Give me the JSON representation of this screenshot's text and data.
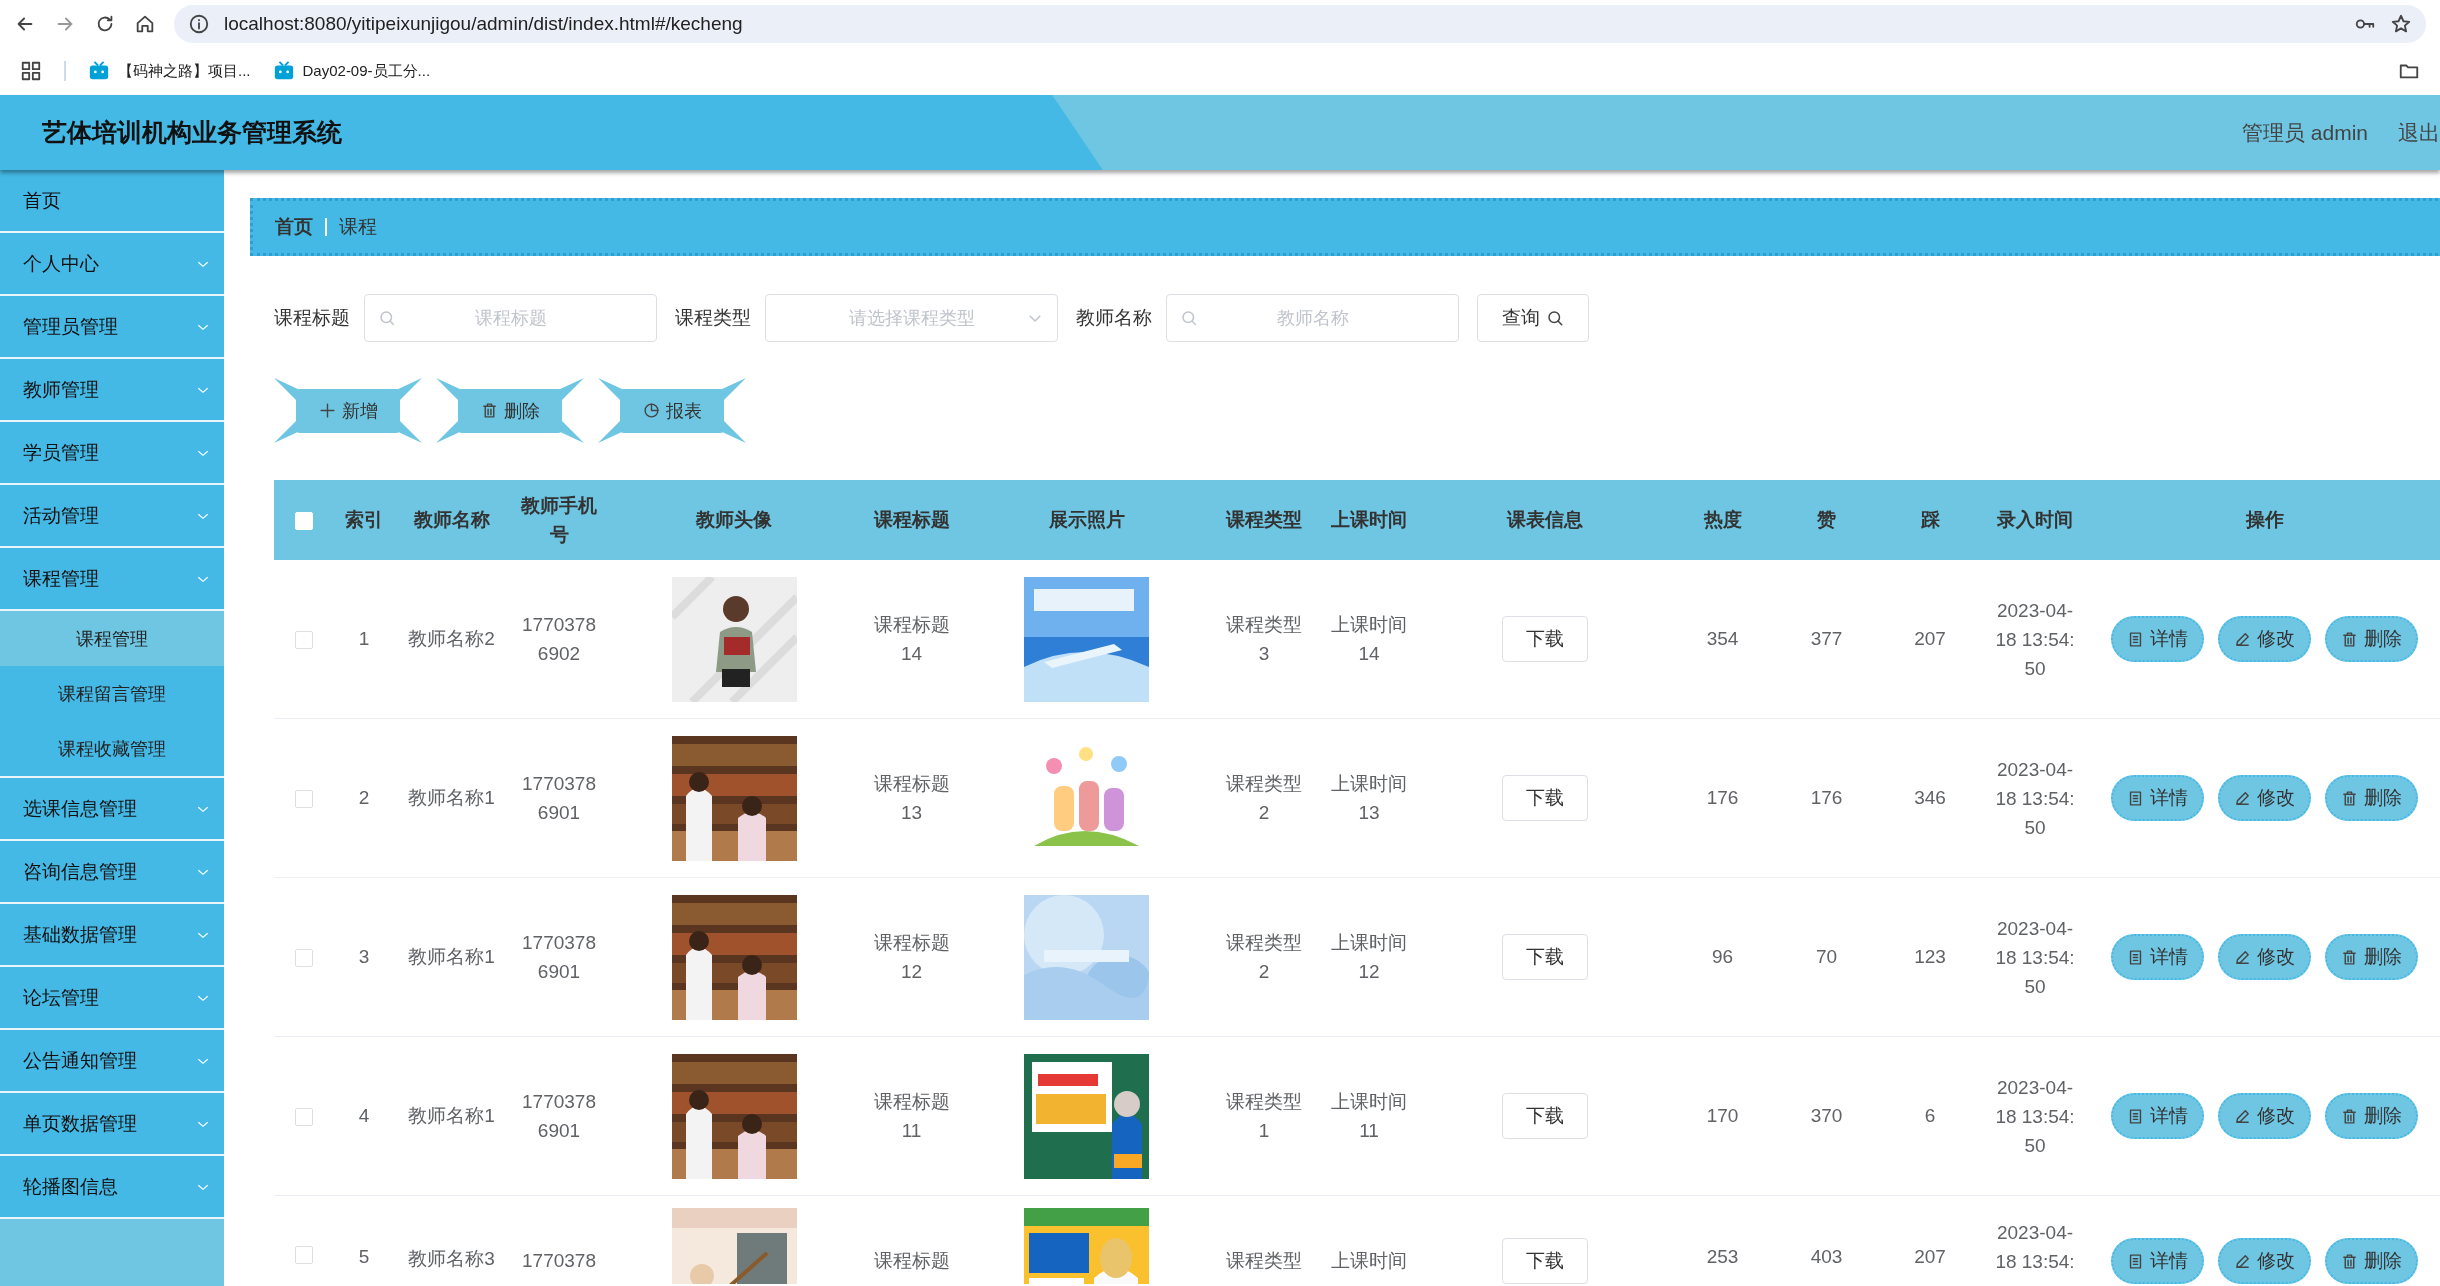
{
  "browser": {
    "url": "localhost:8080/yitipeixunjigou/admin/dist/index.html#/kecheng",
    "bookmarks": [
      "【码神之路】项目...",
      "Day02-09-员工分..."
    ]
  },
  "header": {
    "title": "艺体培训机构业务管理系统",
    "user": "管理员 admin",
    "logout": "退出"
  },
  "sidebar": {
    "items": [
      {
        "label": "首页",
        "kind": "link"
      },
      {
        "label": "个人中心",
        "kind": "menu"
      },
      {
        "label": "管理员管理",
        "kind": "menu"
      },
      {
        "label": "教师管理",
        "kind": "menu"
      },
      {
        "label": "学员管理",
        "kind": "menu"
      },
      {
        "label": "活动管理",
        "kind": "menu"
      },
      {
        "label": "课程管理",
        "kind": "menu",
        "children": [
          {
            "label": "课程管理",
            "selected": true
          },
          {
            "label": "课程留言管理",
            "selected": false
          },
          {
            "label": "课程收藏管理",
            "selected": false
          }
        ]
      },
      {
        "label": "选课信息管理",
        "kind": "menu"
      },
      {
        "label": "咨询信息管理",
        "kind": "menu"
      },
      {
        "label": "基础数据管理",
        "kind": "menu"
      },
      {
        "label": "论坛管理",
        "kind": "menu"
      },
      {
        "label": "公告通知管理",
        "kind": "menu"
      },
      {
        "label": "单页数据管理",
        "kind": "menu"
      },
      {
        "label": "轮播图信息",
        "kind": "menu"
      }
    ]
  },
  "breadcrumb": [
    "首页",
    "课程"
  ],
  "filters": [
    {
      "label": "课程标题",
      "kind": "search",
      "placeholder": "课程标题"
    },
    {
      "label": "课程类型",
      "kind": "select",
      "placeholder": "请选择课程类型"
    },
    {
      "label": "教师名称",
      "kind": "search",
      "placeholder": "教师名称"
    }
  ],
  "query_button": "查询",
  "actions": [
    {
      "label": "新增",
      "kind": "add"
    },
    {
      "label": "删除",
      "kind": "delete"
    },
    {
      "label": "报表",
      "kind": "report"
    }
  ],
  "table": {
    "select_all_checked": false,
    "columns": [
      "索引",
      "教师名称",
      "教师手机号",
      "教师头像",
      "课程标题",
      "展示照片",
      "课程类型",
      "上课时间",
      "课表信息",
      "热度",
      "赞",
      "踩",
      "录入时间",
      "操作"
    ],
    "rows": [
      {
        "checked": false,
        "cut": false,
        "index": "1",
        "teacher": "教师名称2",
        "phone": "17703786902",
        "avatar": {
          "kind": "picture"
        },
        "title": "课程标题14",
        "photo": {
          "kind": "picture"
        },
        "type": "课程类型3",
        "time": "上课时间14",
        "schedule": "下载",
        "heat": "354",
        "likes": "377",
        "dislikes": "207",
        "created": "2023-04-18 13:54:50",
        "actions": [
          "详情",
          "修改",
          "删除"
        ]
      },
      {
        "checked": false,
        "cut": false,
        "index": "2",
        "teacher": "教师名称1",
        "phone": "17703786901",
        "avatar": {
          "kind": "picture"
        },
        "title": "课程标题13",
        "photo": {
          "kind": "picture"
        },
        "type": "课程类型2",
        "time": "上课时间13",
        "schedule": "下载",
        "heat": "176",
        "likes": "176",
        "dislikes": "346",
        "created": "2023-04-18 13:54:50",
        "actions": [
          "详情",
          "修改",
          "删除"
        ]
      },
      {
        "checked": false,
        "cut": false,
        "index": "3",
        "teacher": "教师名称1",
        "phone": "17703786901",
        "avatar": {
          "kind": "picture"
        },
        "title": "课程标题12",
        "photo": {
          "kind": "picture"
        },
        "type": "课程类型2",
        "time": "上课时间12",
        "schedule": "下载",
        "heat": "96",
        "likes": "70",
        "dislikes": "123",
        "created": "2023-04-18 13:54:50",
        "actions": [
          "详情",
          "修改",
          "删除"
        ]
      },
      {
        "checked": false,
        "cut": false,
        "index": "4",
        "teacher": "教师名称1",
        "phone": "17703786901",
        "avatar": {
          "kind": "picture"
        },
        "title": "课程标题11",
        "photo": {
          "kind": "picture"
        },
        "type": "课程类型1",
        "time": "上课时间11",
        "schedule": "下载",
        "heat": "170",
        "likes": "370",
        "dislikes": "6",
        "created": "2023-04-18 13:54:50",
        "actions": [
          "详情",
          "修改",
          "删除"
        ]
      },
      {
        "checked": false,
        "cut": true,
        "index": "5",
        "teacher": "教师名称3",
        "phone": "1770378",
        "avatar": {
          "kind": "picture"
        },
        "title": "课程标题",
        "photo": {
          "kind": "picture"
        },
        "type": "课程类型",
        "time": "上课时间",
        "schedule": "下载",
        "heat": "253",
        "likes": "403",
        "dislikes": "207",
        "created": "2023-04-18 13:54:",
        "actions": [
          "详情",
          "修改",
          "删除"
        ]
      }
    ]
  }
}
